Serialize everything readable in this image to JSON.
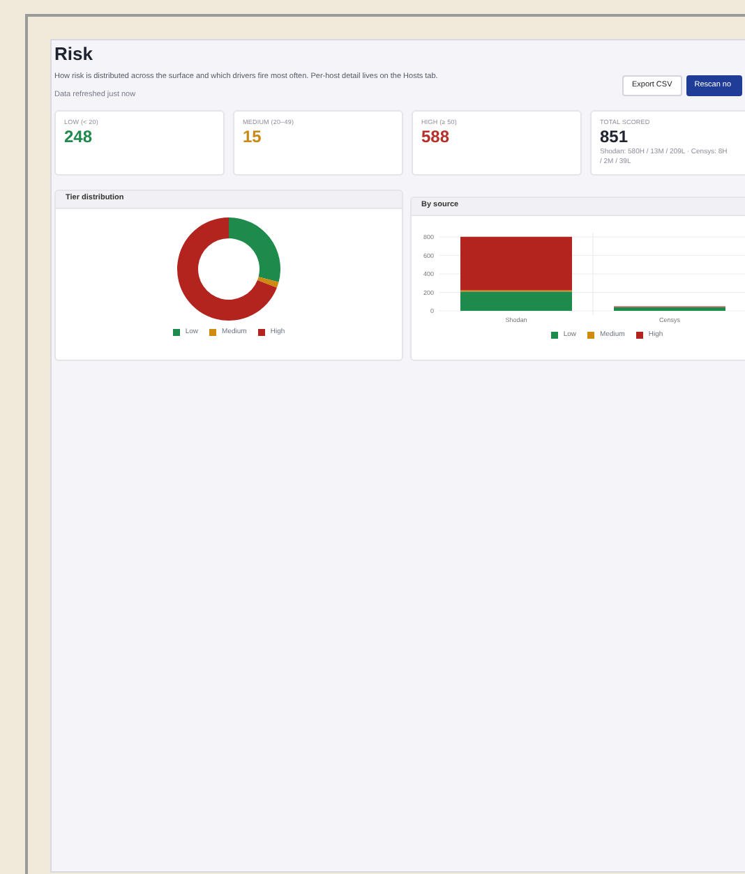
{
  "header": {
    "title": "Risk",
    "description": "How risk is distributed across the surface and which drivers fire most often. Per-host detail lives on the Hosts tab.",
    "refreshed": "Data refreshed just now"
  },
  "buttons": [
    {
      "label": "Export CSV",
      "kind": "secondary"
    },
    {
      "label": "Rescan no",
      "kind": "primary"
    }
  ],
  "stats": [
    {
      "label": "LOW (< 20)",
      "value": "248",
      "color": "#1f8a4c"
    },
    {
      "label": "MEDIUM (20–49)",
      "value": "15",
      "color": "#c98a1a"
    },
    {
      "label": "HIGH (≥ 50)",
      "value": "588",
      "color": "#b8302a"
    },
    {
      "label": "TOTAL SCORED",
      "value": "851",
      "color": "#1f2430",
      "note": "Shodan: 580H / 13M / 209L · Censys: 8H / 2M / 39L"
    }
  ],
  "tier_panel": {
    "title": "Tier distribution",
    "chart_data": {
      "type": "donut",
      "legend": "bottom",
      "categories": [
        "Low",
        "Medium",
        "High"
      ],
      "values": [
        29.1,
        1.8,
        69.1
      ],
      "colors": [
        "#1e8a4c",
        "#d08a10",
        "#b3241f"
      ]
    }
  },
  "source_panel": {
    "title": "By source",
    "chart_data": {
      "type": "bar",
      "stacked": true,
      "legend": "bottom",
      "grid": true,
      "categories": [
        "Shodan",
        "Censys"
      ],
      "yticks": [
        0,
        200,
        400,
        600,
        800
      ],
      "ylim": [
        0,
        800
      ],
      "series": [
        {
          "name": "Low",
          "color": "#1e8a4c",
          "values": [
            209,
            39
          ]
        },
        {
          "name": "Medium",
          "color": "#d08a10",
          "values": [
            13,
            2
          ]
        },
        {
          "name": "High",
          "color": "#b3241f",
          "values": [
            580,
            8
          ]
        }
      ]
    }
  }
}
